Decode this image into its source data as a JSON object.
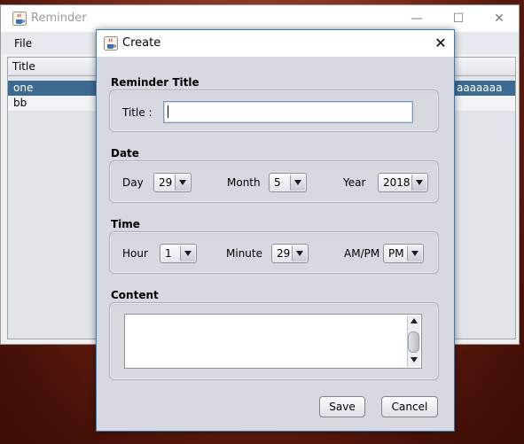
{
  "background_window": {
    "title": "Reminder",
    "controls": {
      "minimize": "—",
      "maximize": "☐",
      "close": "✕"
    },
    "menu": {
      "file": "File"
    },
    "table": {
      "header": "Title",
      "rows": [
        {
          "title": "one",
          "right_text": "aaaaaaa",
          "selected": true
        },
        {
          "title": "bb",
          "right_text": "",
          "selected": false
        }
      ]
    }
  },
  "dialog": {
    "title": "Create",
    "close_glyph": "✕",
    "reminder_title_section": {
      "heading": "Reminder Title",
      "label": "Title :",
      "value": ""
    },
    "date_section": {
      "heading": "Date",
      "day_label": "Day",
      "day_value": "29",
      "month_label": "Month",
      "month_value": "5",
      "year_label": "Year",
      "year_value": "2018"
    },
    "time_section": {
      "heading": "Time",
      "hour_label": "Hour",
      "hour_value": "1",
      "minute_label": "Minute",
      "minute_value": "29",
      "ampm_label": "AM/PM",
      "ampm_value": "PM"
    },
    "content_section": {
      "heading": "Content",
      "value": ""
    },
    "buttons": {
      "save": "Save",
      "cancel": "Cancel"
    }
  },
  "colors": {
    "selection": "#3d6b8f",
    "dialog_border": "#2e7bbd",
    "panel_bg": "#d6d9df"
  },
  "icons": {
    "app_icon": "java-coffee-cup-icon"
  }
}
